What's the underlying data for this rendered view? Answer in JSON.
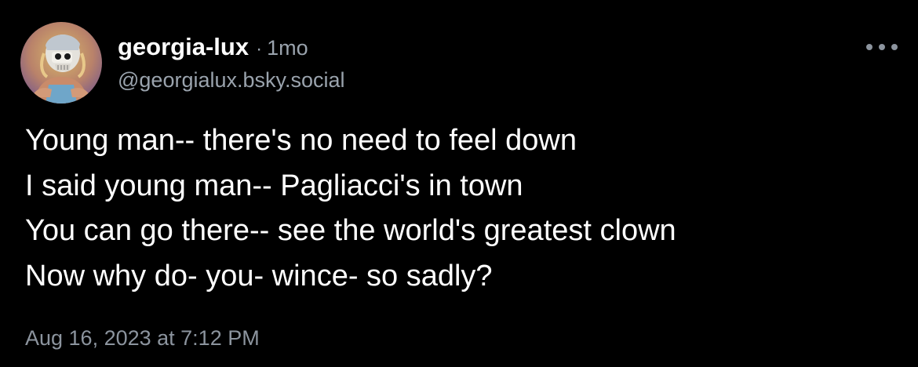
{
  "post": {
    "author": {
      "display_name": "georgia-lux",
      "handle": "@georgialux.bsky.social",
      "avatar": "avatar-illustration-skull-mask"
    },
    "separator": "·",
    "time_ago": "1mo",
    "more_icon": "ellipsis-icon",
    "lines": [
      "Young man-- there's no need to feel down",
      "I said young man-- Pagliacci's in town",
      "You can go there-- see the world's greatest clown",
      "Now why do- you- wince- so sadly?"
    ],
    "timestamp": "Aug 16, 2023 at 7:12 PM"
  },
  "colors": {
    "background": "#000000",
    "text": "#ffffff",
    "muted": "#9aa3ad"
  }
}
